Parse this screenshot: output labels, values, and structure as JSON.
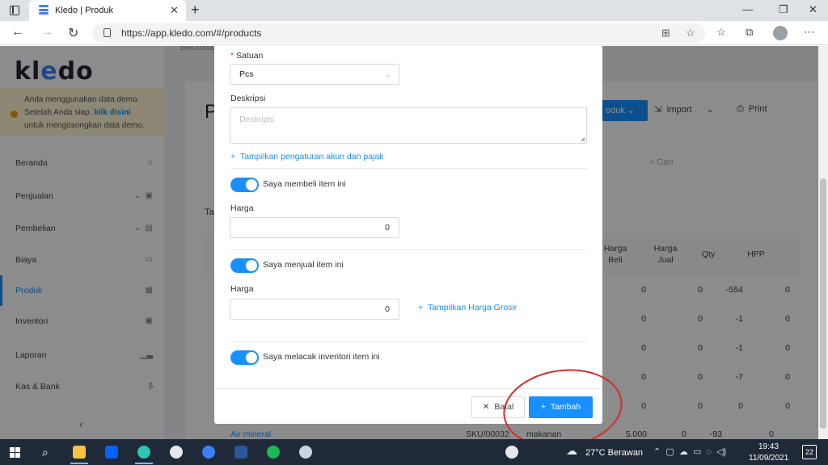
{
  "browser": {
    "tab_title": "Kledo | Produk",
    "url": "https://app.kledo.com/#/products"
  },
  "sidebar": {
    "logo_left": "kl",
    "logo_mid": "e",
    "logo_right": "do",
    "demo_line1": "Anda menggunakan data demo.",
    "demo_line2_a": "Setelah Anda siap, ",
    "demo_line2_b": "klik disini",
    "demo_line3": "untuk mengosongkan data demo.",
    "items": [
      {
        "label": "Beranda"
      },
      {
        "label": "Penjualan"
      },
      {
        "label": "Pembelian"
      },
      {
        "label": "Biaya"
      },
      {
        "label": "Produk"
      },
      {
        "label": "Inventori"
      },
      {
        "label": "Laporan"
      },
      {
        "label": "Kas & Bank"
      }
    ],
    "collapse": "‹"
  },
  "main": {
    "crumb": "Beranda",
    "page_initial": "P",
    "produk_button": "oduk",
    "import_button": "Import",
    "print_button": "Print",
    "search_placeholder": "Cari",
    "tag_partial": "Tan",
    "columns": [
      "Harga Beli",
      "Harga Jual",
      "Qty",
      "HPP"
    ],
    "rows": [
      {
        "beli": "0",
        "jual": "0",
        "qty": "-554",
        "hpp": "0"
      },
      {
        "beli": "0",
        "jual": "0",
        "qty": "-1",
        "hpp": "0"
      },
      {
        "beli": "0",
        "jual": "0",
        "qty": "-1",
        "hpp": "0"
      },
      {
        "beli": "0",
        "jual": "0",
        "qty": "-7",
        "hpp": "0"
      },
      {
        "beli": "0",
        "jual": "0",
        "qty": "0",
        "hpp": "0"
      }
    ],
    "last_row": {
      "name": "Air mineral",
      "sku": "SKU/00032",
      "kategori": "makanan",
      "beli": "5.000",
      "jual": "0",
      "qty": "-93",
      "hpp": "0"
    }
  },
  "modal": {
    "satuan_label": "Satuan",
    "satuan_value": "Pcs",
    "deskripsi_label": "Deskripsi",
    "deskripsi_placeholder": "Deskripsi",
    "account_link": "Tampilkan pengaturan akun dan pajak",
    "buy_toggle": "Saya membeli item ini",
    "buy_price_label": "Harga",
    "buy_price_value": "0",
    "sell_toggle": "Saya menjual item ini",
    "sell_price_label": "Harga",
    "sell_price_value": "0",
    "wholesale_link": "Tampilkan Harga Grosir",
    "track_toggle": "Saya melacak inventori item ini",
    "cancel_button": "Batal",
    "submit_button": "Tambah"
  },
  "taskbar": {
    "weather": "27°C  Berawan",
    "time": "19:43",
    "date": "11/09/2021",
    "notifications": "22"
  },
  "colors": {
    "primary": "#1890ff",
    "annotation": "#d42b2b"
  }
}
